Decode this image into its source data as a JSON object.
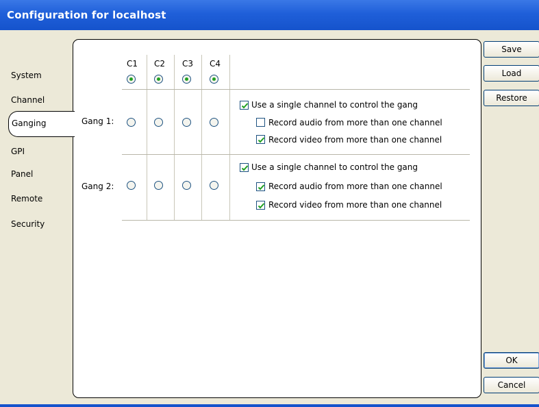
{
  "window": {
    "title": "Configuration for localhost"
  },
  "sidebar": {
    "items": [
      {
        "label": "System"
      },
      {
        "label": "Channel"
      },
      {
        "label": "Ganging",
        "selected": true
      },
      {
        "label": "GPI"
      },
      {
        "label": "Panel"
      },
      {
        "label": "Remote"
      },
      {
        "label": "Security"
      }
    ]
  },
  "buttons": {
    "save": "Save",
    "load": "Load",
    "restore": "Restore",
    "ok": "OK",
    "cancel": "Cancel"
  },
  "ganging": {
    "columns": [
      "C1",
      "C2",
      "C3",
      "C4"
    ],
    "header_radios_selected": [
      true,
      true,
      true,
      true
    ],
    "gangs": [
      {
        "label": "Gang 1:",
        "radios_selected": [
          false,
          false,
          false,
          false
        ],
        "options": [
          {
            "label": "Use a single channel to control the gang",
            "checked": true
          },
          {
            "label": "Record audio from more than one channel",
            "checked": false
          },
          {
            "label": "Record video from more than one channel",
            "checked": true
          }
        ]
      },
      {
        "label": "Gang 2:",
        "radios_selected": [
          false,
          false,
          false,
          false
        ],
        "options": [
          {
            "label": "Use a single channel to control the gang",
            "checked": true
          },
          {
            "label": "Record audio from more than one channel",
            "checked": true
          },
          {
            "label": "Record video from more than one channel",
            "checked": true
          }
        ]
      }
    ]
  },
  "colors": {
    "titlebar": "#1f5fd9",
    "frame": "#ece9d8",
    "check": "#21a121"
  },
  "icons": {
    "radio_selected": "green-dot",
    "checkbox_checked": "green-checkmark"
  }
}
